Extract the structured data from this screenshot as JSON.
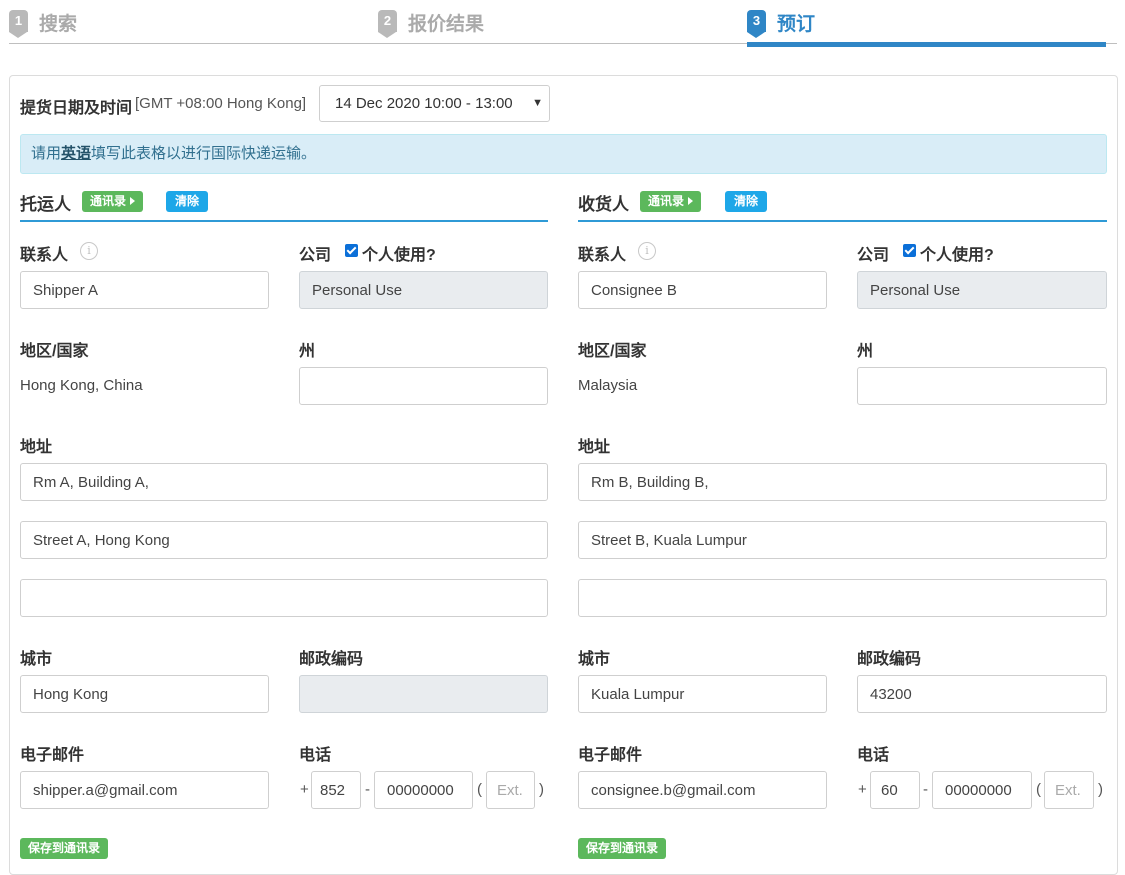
{
  "steps": [
    {
      "num": "1",
      "label": "搜索"
    },
    {
      "num": "2",
      "label": "报价结果"
    },
    {
      "num": "3",
      "label": "预订"
    }
  ],
  "pickup": {
    "label": "提货日期及时间",
    "timezone": "[GMT +08:00 Hong Kong]",
    "selected": "14 Dec 2020 10:00 - 13:00"
  },
  "alert": {
    "prefix": "请用",
    "highlight": "英语",
    "suffix": "填写此表格以进行国际快递运输。"
  },
  "colors": {
    "accent": "#2f86c6",
    "green": "#5cb85c",
    "blue": "#1ea7e8",
    "alert_bg": "#d9edf7"
  },
  "shipper": {
    "title": "托运人",
    "contacts_btn": "通讯录",
    "clear_btn": "清除",
    "contact_label": "联系人",
    "contact": "Shipper A",
    "company_label": "公司",
    "personal_label": "个人使用?",
    "company": "Personal Use",
    "country_label": "地区/国家",
    "country": "Hong Kong, China",
    "state_label": "州",
    "state": "",
    "address_label": "地址",
    "address1": "Rm A, Building A,",
    "address2": "Street A, Hong Kong",
    "address3": "",
    "city_label": "城市",
    "city": "Hong Kong",
    "postal_label": "邮政编码",
    "postal": "",
    "email_label": "电子邮件",
    "email": "shipper.a@gmail.com",
    "phone_label": "电话",
    "phone_code": "852",
    "phone_number": "00000000",
    "ext_placeholder": "Ext.",
    "save_btn": "保存到通讯录"
  },
  "consignee": {
    "title": "收货人",
    "contacts_btn": "通讯录",
    "clear_btn": "清除",
    "contact_label": "联系人",
    "contact": "Consignee B",
    "company_label": "公司",
    "personal_label": "个人使用?",
    "company": "Personal Use",
    "country_label": "地区/国家",
    "country": "Malaysia",
    "state_label": "州",
    "state": "",
    "address_label": "地址",
    "address1": "Rm B, Building B,",
    "address2": "Street B, Kuala Lumpur",
    "address3": "",
    "city_label": "城市",
    "city": "Kuala Lumpur",
    "postal_label": "邮政编码",
    "postal": "43200",
    "email_label": "电子邮件",
    "email": "consignee.b@gmail.com",
    "phone_label": "电话",
    "phone_code": "60",
    "phone_number": "00000000",
    "ext_placeholder": "Ext.",
    "save_btn": "保存到通讯录"
  },
  "phone_symbols": {
    "plus": "+",
    "dash": "-",
    "open": "(",
    "close": ")"
  },
  "icons": {
    "info": "info-icon",
    "next": "triangle-right-icon",
    "dropdown": "chevron-down-icon",
    "check": "checkbox-checked-icon"
  }
}
